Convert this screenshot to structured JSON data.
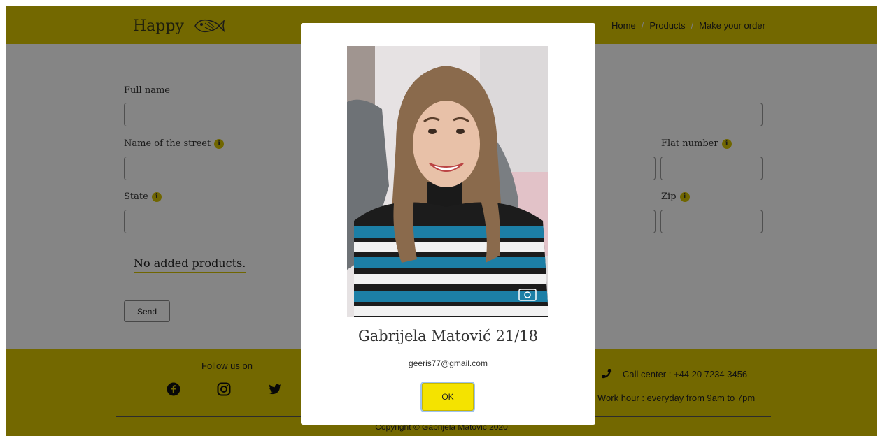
{
  "header": {
    "logo_text": "Happy",
    "logo_icon": "fish-icon",
    "breadcrumb": [
      "Home",
      "Products",
      "Make your order"
    ],
    "separator": "/"
  },
  "form": {
    "full_name_label": "Full name",
    "street_label": "Name of the street",
    "flat_label": "Flat number",
    "state_label": "State",
    "zip_label": "Zip",
    "info_glyph": "i",
    "no_products": "No added products.",
    "send_label": "Send"
  },
  "footer": {
    "follow_text": "Follow us on",
    "social_icons": [
      "facebook-icon",
      "instagram-icon",
      "twitter-icon"
    ],
    "call_center": "Call center : +44 20 7234 3456",
    "work_hour": "Work hour : everyday from 9am to 7pm",
    "copyright": "Copyright © Gabrijela Matovic 2020"
  },
  "modal": {
    "name": "Gabrijela Matović 21/18",
    "email": "geeris77@gmail.com",
    "ok_label": "OK"
  },
  "colors": {
    "brand_yellow": "#dcc800",
    "button_yellow": "#f4e300",
    "overlay": "rgba(0,0,0,0.48)"
  }
}
